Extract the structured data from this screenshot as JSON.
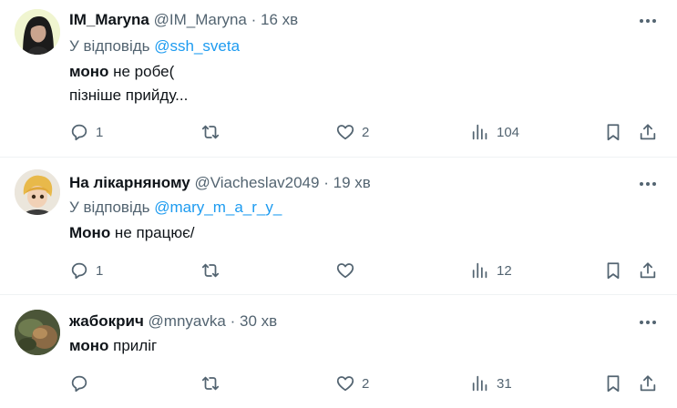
{
  "tweets": [
    {
      "name": "IM_Maryna",
      "handle": "@IM_Maryna",
      "separator": "·",
      "time": "16 хв",
      "reply_prefix": "У відповідь",
      "reply_to": "@ssh_sveta",
      "text_bold": "моно",
      "text_rest": " не робе(",
      "text_line2": "пізніше прийду...",
      "replies": "1",
      "retweets": "",
      "likes": "2",
      "views": "104"
    },
    {
      "name": "На лікарняному",
      "handle": "@Viacheslav2049",
      "separator": "·",
      "time": "19 хв",
      "reply_prefix": "У відповідь",
      "reply_to": "@mary_m_a_r_y_",
      "text_bold": "Моно",
      "text_rest": " не працює/",
      "replies": "1",
      "retweets": "",
      "likes": "",
      "views": "12"
    },
    {
      "name": "жабокрич",
      "handle": "@mnyavka",
      "separator": "·",
      "time": "30 хв",
      "text_bold": "моно",
      "text_rest": " приліг",
      "replies": "",
      "retweets": "",
      "likes": "2",
      "views": "31"
    }
  ],
  "colors": {
    "text": "#0f1419",
    "secondary": "#536471",
    "mention": "#1d9bf0",
    "divider": "#eff3f4"
  },
  "icons": [
    "more-icon",
    "reply-icon",
    "retweet-icon",
    "like-icon",
    "views-icon",
    "bookmark-icon",
    "share-icon"
  ]
}
